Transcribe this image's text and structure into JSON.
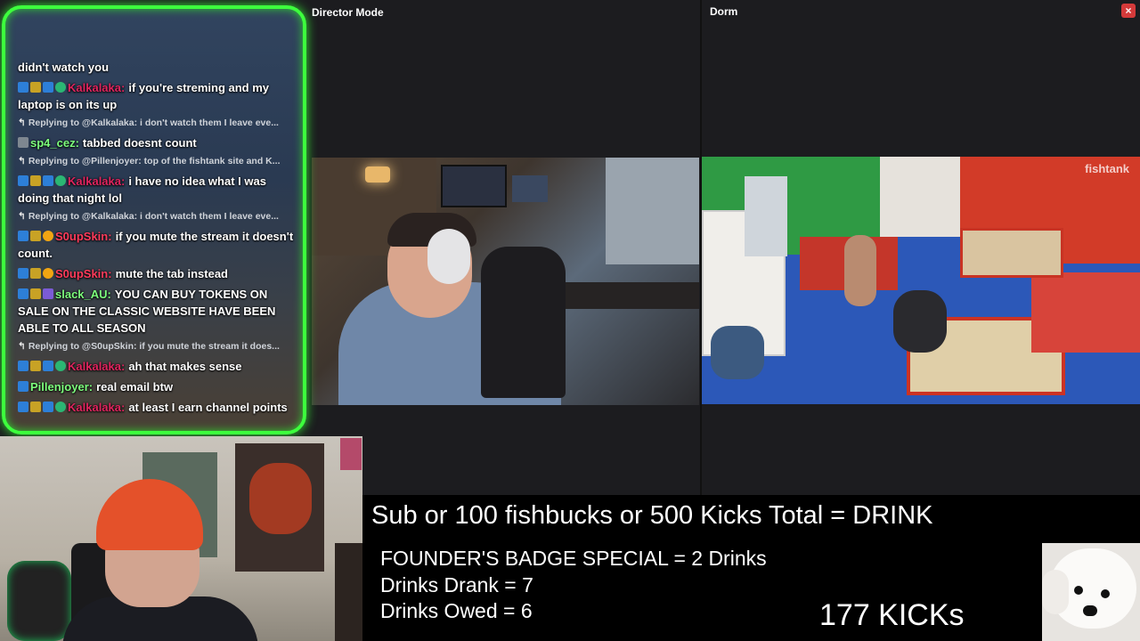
{
  "panels": {
    "director_title": "Director Mode",
    "dorm_title": "Dorm",
    "dorm_watermark": "fishtank",
    "close_symbol": "×"
  },
  "chat": {
    "top_text": "didn't watch you",
    "messages": [
      {
        "type": "msg",
        "badges": [
          "blue",
          "crown",
          "blue",
          "green"
        ],
        "user": "Kalkalaka:",
        "user_color": "#e0245e",
        "text": "if you're streming and my laptop is on its up"
      },
      {
        "type": "reply",
        "text": "Replying to @Kalkalaka: i don't watch them I leave eve..."
      },
      {
        "type": "msg",
        "badges": [
          "grey"
        ],
        "user": "sp4_cez:",
        "user_color": "#7dff7d",
        "text": "tabbed doesnt count"
      },
      {
        "type": "reply",
        "text": "Replying to @Pillenjoyer: top of the fishtank site and K..."
      },
      {
        "type": "msg",
        "badges": [
          "blue",
          "crown",
          "blue",
          "green"
        ],
        "user": "Kalkalaka:",
        "user_color": "#e0245e",
        "text": "i have no idea what I was doing that night lol"
      },
      {
        "type": "reply",
        "text": "Replying to @Kalkalaka: i don't watch them I leave eve..."
      },
      {
        "type": "msg",
        "badges": [
          "blue",
          "crown",
          "orange"
        ],
        "user": "S0upSkin:",
        "user_color": "#ff3b5b",
        "text": "if you mute the stream it doesn't count."
      },
      {
        "type": "msg",
        "badges": [
          "blue",
          "crown",
          "orange"
        ],
        "user": "S0upSkin:",
        "user_color": "#ff3b5b",
        "text": "mute the tab instead"
      },
      {
        "type": "msg",
        "badges": [
          "blue",
          "crown",
          "purple"
        ],
        "user": "slack_AU:",
        "user_color": "#7dff7d",
        "text": "YOU CAN BUY TOKENS ON SALE ON THE CLASSIC WEBSITE HAVE BEEN ABLE TO ALL SEASON"
      },
      {
        "type": "reply",
        "text": "Replying to @S0upSkin: if you mute the stream it does..."
      },
      {
        "type": "msg",
        "badges": [
          "blue",
          "crown",
          "blue",
          "green"
        ],
        "user": "Kalkalaka:",
        "user_color": "#e0245e",
        "text": "ah that makes sense"
      },
      {
        "type": "msg",
        "badges": [
          "blue"
        ],
        "user": "Pillenjoyer:",
        "user_color": "#7dff7d",
        "text": "real email btw"
      },
      {
        "type": "msg",
        "badges": [
          "blue",
          "crown",
          "blue",
          "green"
        ],
        "user": "Kalkalaka:",
        "user_color": "#e0245e",
        "text": "at least I earn channel points"
      }
    ]
  },
  "info": {
    "headline": "Sub or 100 fishbucks or 500 Kicks Total = DRINK",
    "founder": "FOUNDER'S BADGE SPECIAL = 2 Drinks",
    "drank": "Drinks Drank = 7",
    "owed": "Drinks Owed = 6",
    "kicks": "177 KICKs"
  }
}
